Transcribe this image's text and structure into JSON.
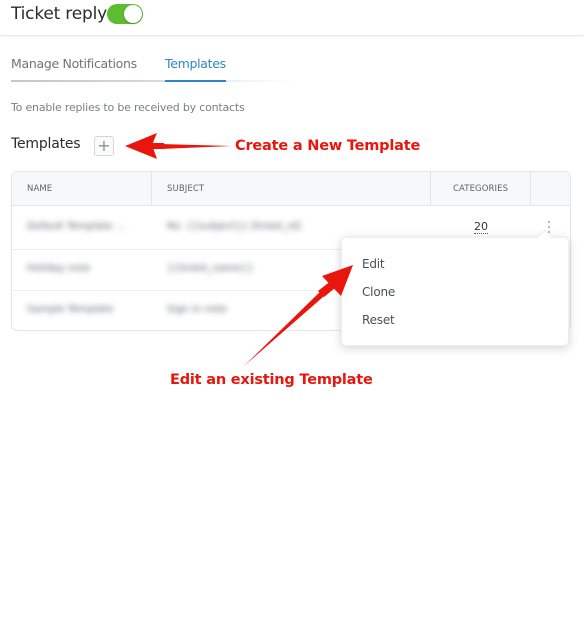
{
  "header": {
    "title": "Ticket reply",
    "toggle_state": "on",
    "toggle_color": "#5bbd2f"
  },
  "tabs": [
    {
      "label": "Manage Notifications",
      "active": false
    },
    {
      "label": "Templates",
      "active": true
    }
  ],
  "accent_color": "#2f86c5",
  "hint": "To enable replies to be received by contacts",
  "templates_section": {
    "title": "Templates",
    "add_icon": "plus-icon",
    "add_glyph": "+"
  },
  "table": {
    "columns": [
      "NAME",
      "SUBJECT",
      "CATEGORIES"
    ],
    "rows": [
      {
        "name": "Default Template ...",
        "subject": "Re: {{subject}} [ticket_id]",
        "categories": "20",
        "blurred": true
      },
      {
        "name": "Holiday note",
        "subject": "{{ticket_name}}",
        "categories": "",
        "blurred": true
      },
      {
        "name": "Sample Template",
        "subject": "Sign in note",
        "categories": "",
        "blurred": true
      }
    ],
    "row_menu_icon": "kebab-vertical-icon"
  },
  "context_menu": {
    "items": [
      "Edit",
      "Clone",
      "Reset"
    ]
  },
  "annotations": {
    "create": "Create a New Template",
    "edit": "Edit an existing Template",
    "color": "#e8160c"
  }
}
